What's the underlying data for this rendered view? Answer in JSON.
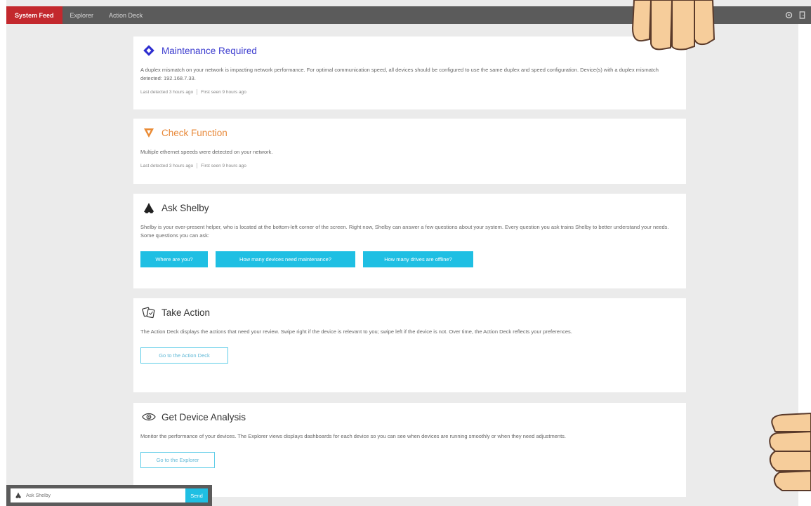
{
  "nav": {
    "tabs": [
      {
        "label": "System Feed",
        "active": true
      },
      {
        "label": "Explorer",
        "active": false
      },
      {
        "label": "Action Deck",
        "active": false
      }
    ],
    "icons": [
      "gear-icon",
      "exit-icon"
    ]
  },
  "cards": {
    "maintenance": {
      "title": "Maintenance Required",
      "body": "A duplex mismatch on your network is impacting network performance. For optimal communication speed, all devices should be configured to use the same duplex and speed configuration. Device(s) with a duplex mismatch detected: 192.168.7.33.",
      "meta_first": "Last detected 3 hours ago",
      "meta_second": "First seen 9 hours ago",
      "icon": "diamond-alert-icon",
      "color": "#3c3ccf"
    },
    "check_function": {
      "title": "Check Function",
      "body": "Multiple ethernet speeds were detected on your network.",
      "meta_first": "Last detected 3 hours ago",
      "meta_second": "First seen 9 hours ago",
      "icon": "triangle-warning-icon",
      "color": "#e8893a"
    },
    "ask_shelby": {
      "title": "Ask Shelby",
      "body": "Shelby is your ever-present helper, who is located at the bottom-left corner of the screen. Right now, Shelby can answer a few questions about your system. Every question you ask trains Shelby to better understand your needs. Some questions you can ask:",
      "buttons": [
        "Where are you?",
        "How many devices need maintenance?",
        "How many drives are offline?"
      ],
      "icon": "shelby-icon"
    },
    "take_action": {
      "title": "Take Action",
      "body": "The Action Deck displays the actions that need your review. Swipe right if the device is relevant to you; swipe left if the device is not. Over time, the Action Deck reflects your preferences.",
      "button": "Go to the Action Deck",
      "icon": "cards-icon"
    },
    "device_analysis": {
      "title": "Get Device Analysis",
      "body": "Monitor the performance of your devices. The Explorer views displays dashboards for each device so you can see when devices are running smoothly or when they need adjustments.",
      "button": "Go to the Explorer",
      "icon": "eye-icon"
    }
  },
  "ask_bar": {
    "placeholder": "Ask Shelby",
    "send_label": "Send"
  },
  "colors": {
    "nav_bg": "#5b5b5b",
    "active_tab": "#c3282d",
    "accent": "#1fbfe3"
  }
}
